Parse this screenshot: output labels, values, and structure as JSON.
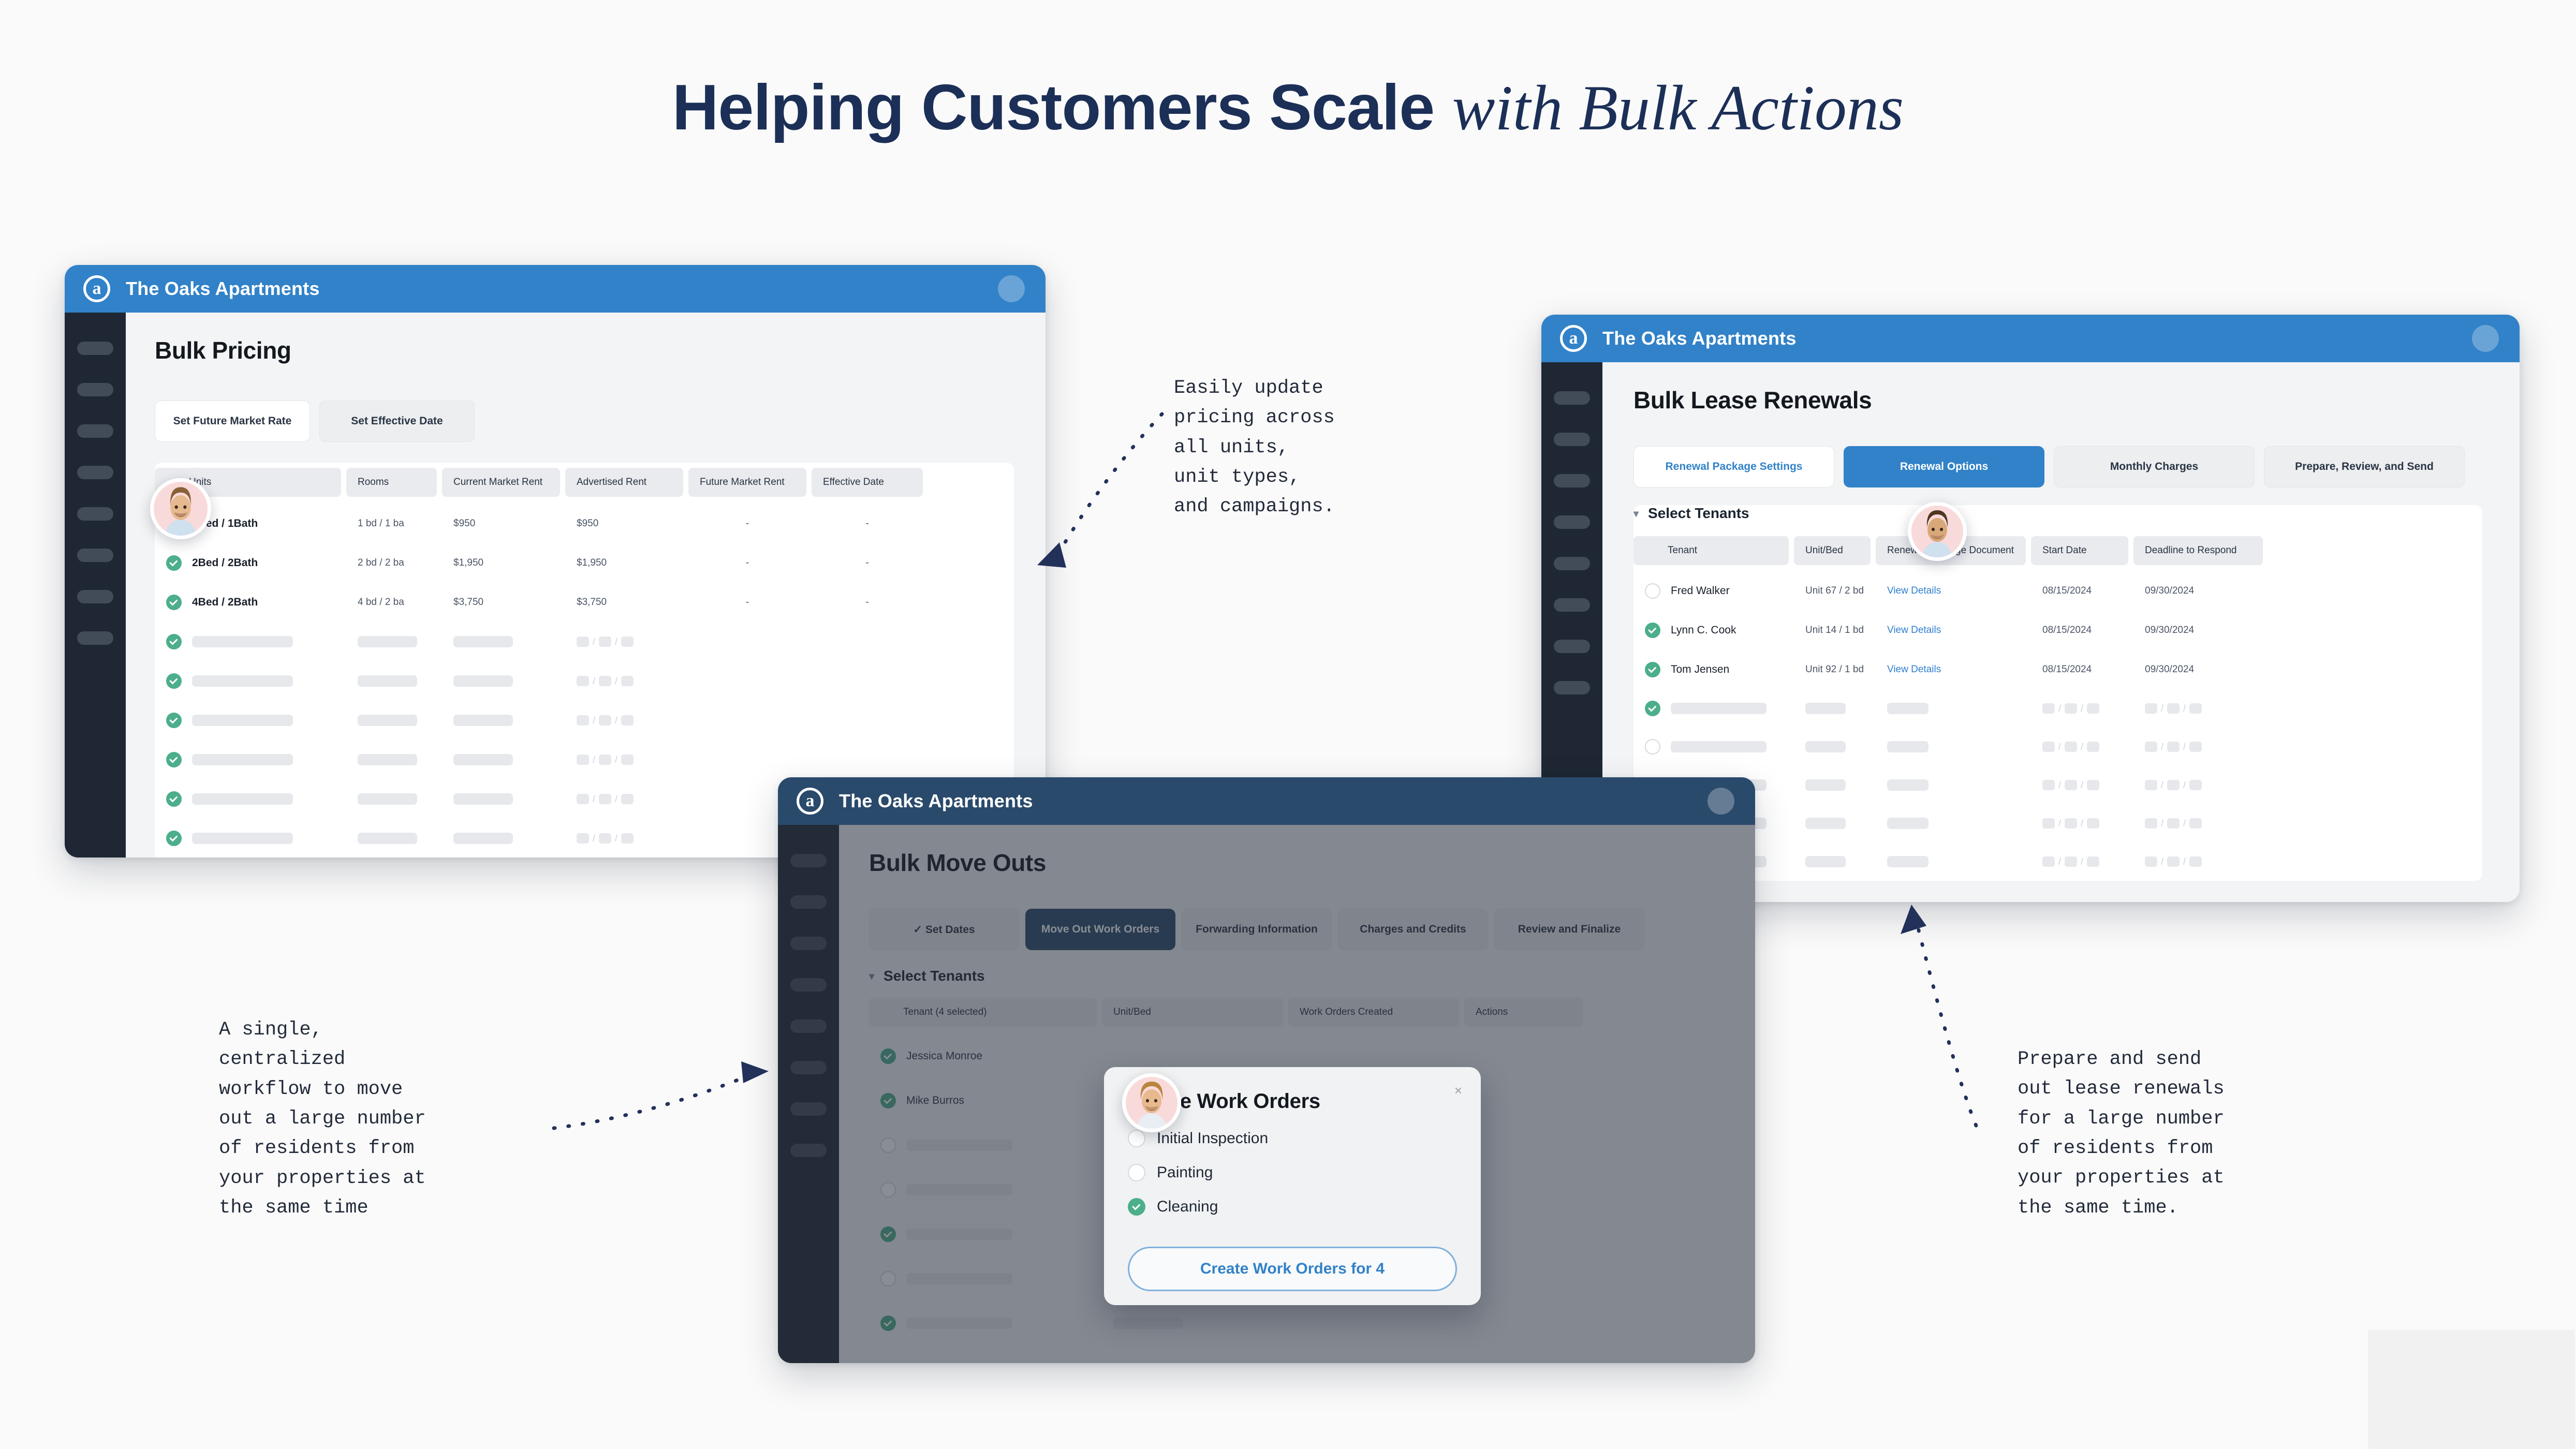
{
  "title": {
    "bold": "Helping Customers Scale",
    "italic": "with Bulk Actions"
  },
  "brand": {
    "app_name": "The Oaks Apartments",
    "logo_glyph": "a",
    "header_blue": "#3182c8",
    "sidebar_dark": "#1e2733",
    "check_green": "#4cae8a",
    "link_blue": "#2f7fd0",
    "title_navy": "#1c2f57"
  },
  "window_pricing": {
    "app_name": "The Oaks Apartments",
    "heading": "Bulk Pricing",
    "tabs": [
      {
        "label": "Set Future Market Rate",
        "state": "white"
      },
      {
        "label": "Set Effective Date",
        "state": "default"
      }
    ],
    "table": {
      "headers": [
        "Units",
        "Rooms",
        "Current Market Rent",
        "Advertised Rent",
        "Future Market Rent",
        "Effective Date"
      ],
      "rows": [
        {
          "units": "1Bed / 1Bath",
          "rooms": "1 bd / 1 ba",
          "current_market_rent": "$950",
          "advertised_rent": "$950",
          "future_market_rent": "-",
          "effective_date": "-",
          "checked": true
        },
        {
          "units": "2Bed / 2Bath",
          "rooms": "2 bd / 2 ba",
          "current_market_rent": "$1,950",
          "advertised_rent": "$1,950",
          "future_market_rent": "-",
          "effective_date": "-",
          "checked": true
        },
        {
          "units": "4Bed / 2Bath",
          "rooms": "4 bd / 2 ba",
          "current_market_rent": "$3,750",
          "advertised_rent": "$3,750",
          "future_market_rent": "-",
          "effective_date": "-",
          "checked": true
        }
      ],
      "placeholder_rows": 7
    }
  },
  "window_moveouts": {
    "app_name": "The Oaks Apartments",
    "heading": "Bulk Move Outs",
    "tabs": [
      {
        "label": "✓  Set Dates",
        "state": "default"
      },
      {
        "label": "Move Out Work Orders",
        "state": "active"
      },
      {
        "label": "Forwarding Information",
        "state": "default"
      },
      {
        "label": "Charges and Credits",
        "state": "default"
      },
      {
        "label": "Review and Finalize",
        "state": "default"
      }
    ],
    "section_label": "Select Tenants",
    "table": {
      "headers": [
        "Tenant (4 selected)",
        "Unit/Bed",
        "Work Orders Created",
        "Actions"
      ],
      "rows": [
        {
          "tenant": "Jessica Monroe",
          "checked": true
        },
        {
          "tenant": "Mike Burros",
          "checked": true
        }
      ],
      "placeholder_rows": 5
    },
    "modal": {
      "title": "Create Work Orders",
      "close_label": "×",
      "options": [
        {
          "label": "Initial Inspection",
          "checked": false
        },
        {
          "label": "Painting",
          "checked": false
        },
        {
          "label": "Cleaning",
          "checked": true
        }
      ],
      "button_label": "Create Work Orders for 4"
    }
  },
  "window_renewals": {
    "app_name": "The Oaks Apartments",
    "heading": "Bulk Lease Renewals",
    "tabs": [
      {
        "label": "Renewal Package Settings",
        "state": "white-bluetext"
      },
      {
        "label": "Renewal Options",
        "state": "blue"
      },
      {
        "label": "Monthly Charges",
        "state": "default"
      },
      {
        "label": "Prepare, Review, and Send",
        "state": "default"
      }
    ],
    "section_label": "Select Tenants",
    "table": {
      "headers": [
        "Tenant",
        "Unit/Bed",
        "Renewal Package Document",
        "Start Date",
        "Deadline to Respond"
      ],
      "rows": [
        {
          "tenant": "Fred Walker",
          "unit_bed": "Unit 67 / 2 bd",
          "document": "View Details",
          "start_date": "08/15/2024",
          "deadline": "09/30/2024",
          "checked": false
        },
        {
          "tenant": "Lynn C. Cook",
          "unit_bed": "Unit 14 / 1 bd",
          "document": "View Details",
          "start_date": "08/15/2024",
          "deadline": "09/30/2024",
          "checked": true
        },
        {
          "tenant": "Tom Jensen",
          "unit_bed": "Unit 92 / 1 bd",
          "document": "View Details",
          "start_date": "08/15/2024",
          "deadline": "09/30/2024",
          "checked": true
        }
      ],
      "placeholder_rows": 5
    }
  },
  "annotations": {
    "pricing": "Easily update\npricing across\nall units,\nunit types,\nand campaigns.",
    "moveouts": "A single,\ncentralized\nworkflow to move\nout a large number\nof residents from\nyour properties at\nthe same time",
    "renewals": "Prepare and send\nout lease renewals\nfor a large number\nof residents from\nyour properties at\nthe same time."
  }
}
